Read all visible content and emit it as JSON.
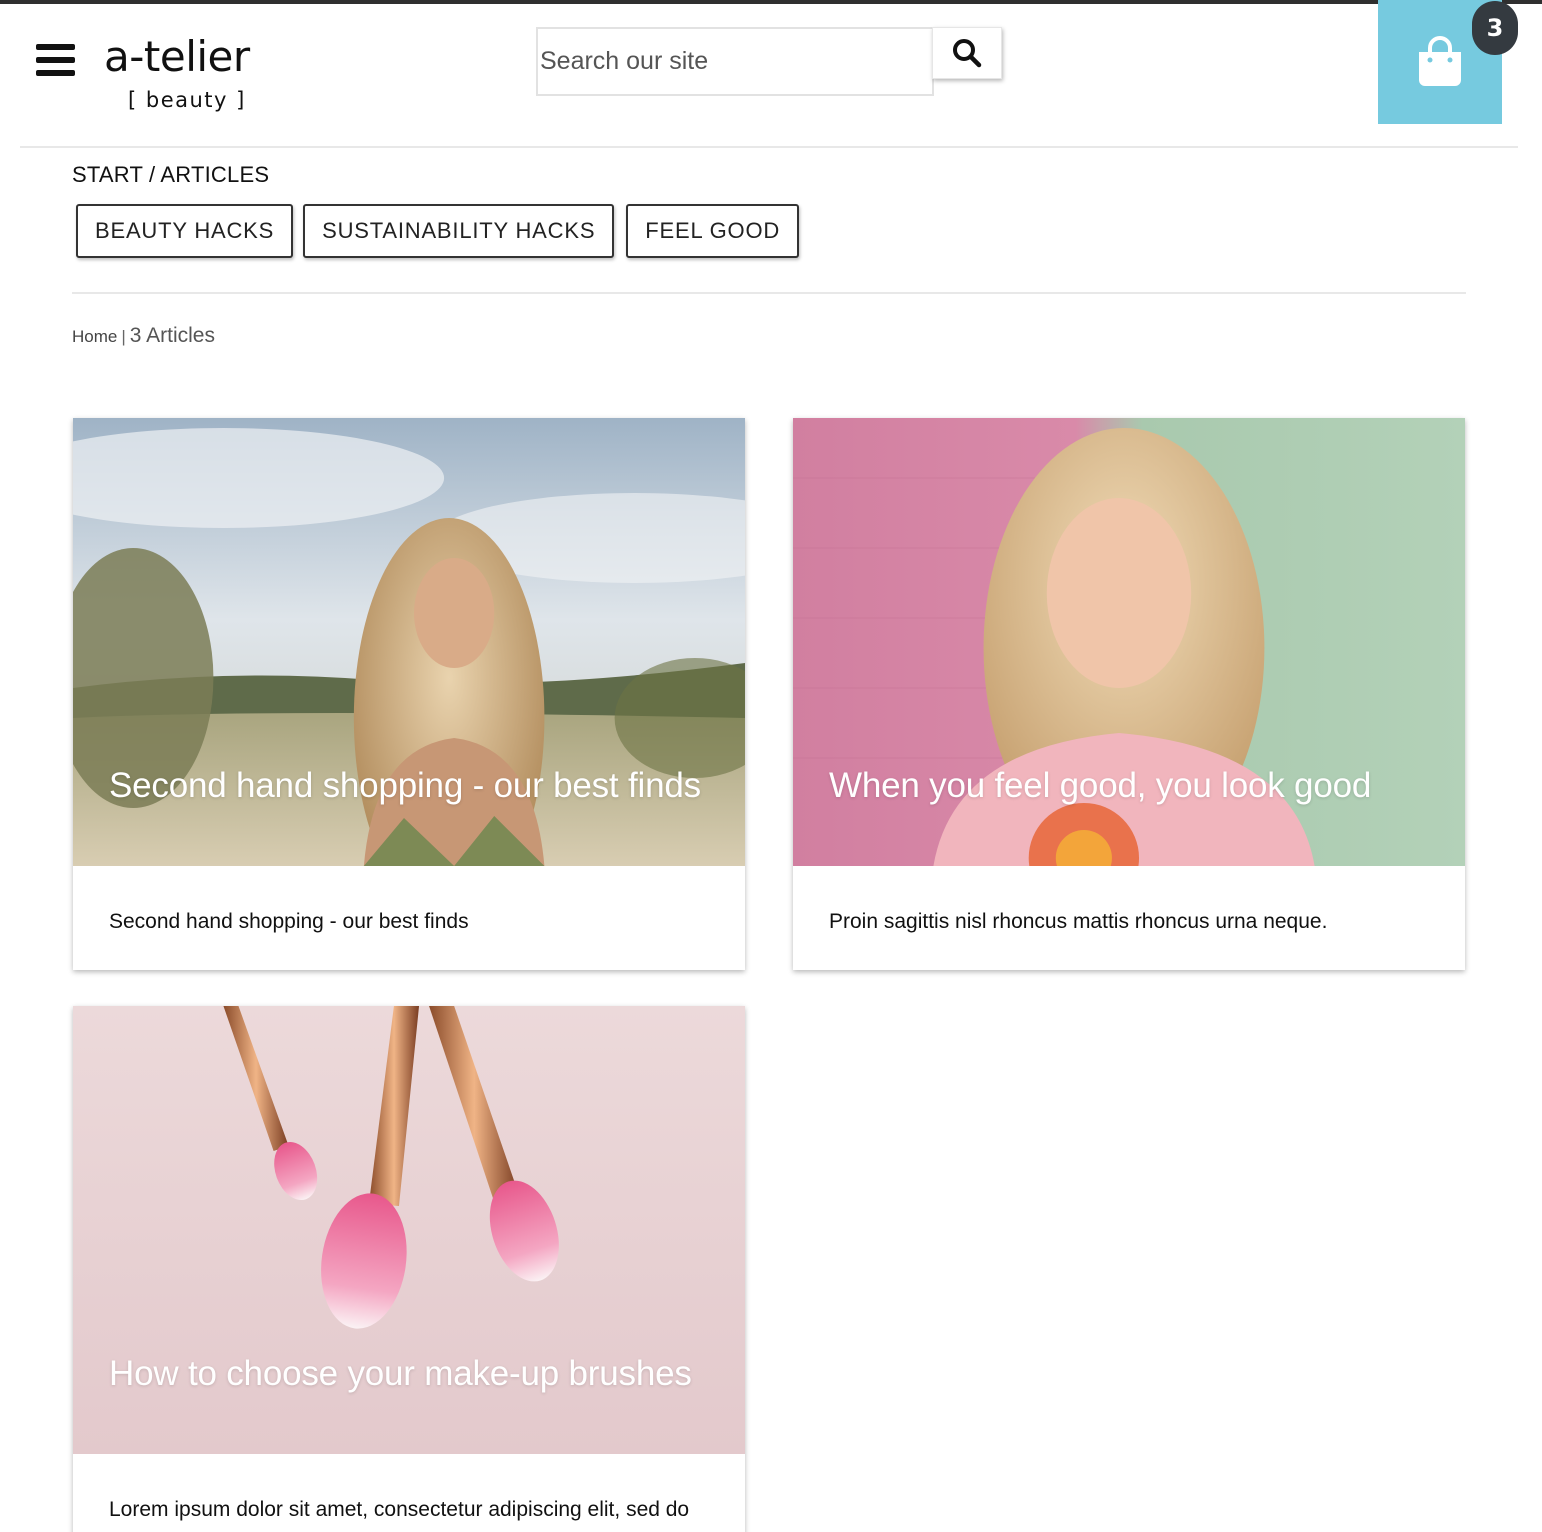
{
  "header": {
    "logo_main": "a-telier",
    "logo_sub": "[ beauty ]",
    "search_placeholder": "Search our site",
    "cart_count": "3"
  },
  "nav": {
    "section_crumb": "START / ARTICLES",
    "tags": [
      "BEAUTY HACKS",
      "SUSTAINABILITY HACKS",
      "FEEL GOOD"
    ]
  },
  "breadcrumb": {
    "home": "Home",
    "separator": "|",
    "count": "3 Articles"
  },
  "articles": [
    {
      "overlay_title": "Second hand shopping - our best finds",
      "excerpt": "Second hand shopping - our best finds"
    },
    {
      "overlay_title": "When you feel good, you look good",
      "excerpt": "Proin sagittis nisl rhoncus mattis rhoncus urna neque."
    },
    {
      "overlay_title": "How to choose your make-up brushes",
      "excerpt": "Lorem ipsum dolor sit amet, consectetur adipiscing elit, sed do"
    }
  ],
  "colors": {
    "cart_bg": "#76cadf",
    "badge_bg": "#343a40",
    "divider": "#e8e8e8"
  },
  "icons": [
    "hamburger-menu-icon",
    "search-icon",
    "shopping-bag-icon"
  ]
}
